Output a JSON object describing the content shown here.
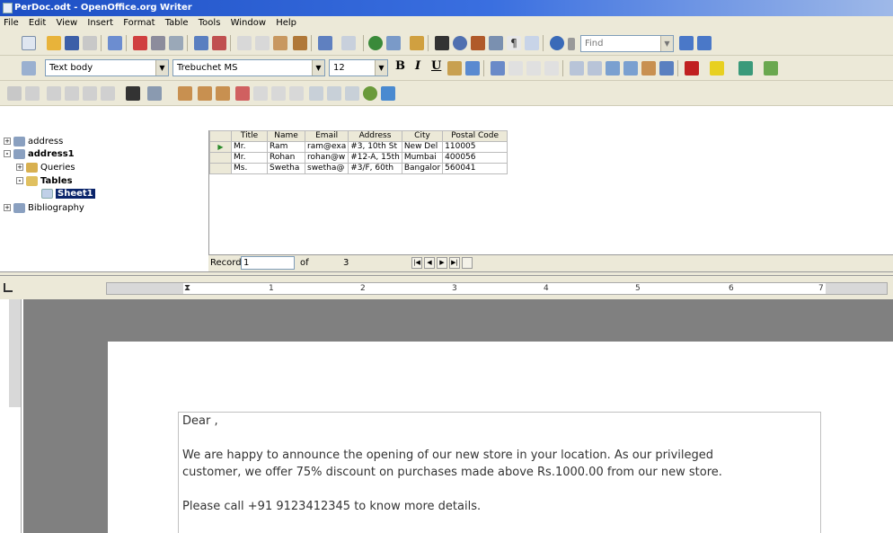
{
  "window": {
    "title": "PerDoc.odt - OpenOffice.org Writer"
  },
  "menu": [
    "File",
    "Edit",
    "View",
    "Insert",
    "Format",
    "Table",
    "Tools",
    "Window",
    "Help"
  ],
  "toolbar": {
    "find_placeholder": "Find",
    "style_value": "Text body",
    "font_value": "Trebuchet MS",
    "size_value": "12"
  },
  "tree": {
    "items": [
      {
        "label": "address",
        "level": 0,
        "expander": "+"
      },
      {
        "label": "address1",
        "level": 0,
        "expander": "-"
      },
      {
        "label": "Queries",
        "level": 1,
        "expander": "+"
      },
      {
        "label": "Tables",
        "level": 1,
        "expander": "-"
      },
      {
        "label": "Sheet1",
        "level": 2,
        "expander": ""
      },
      {
        "label": "Bibliography",
        "level": 0,
        "expander": "+"
      }
    ]
  },
  "grid": {
    "columns": [
      "Title",
      "Name",
      "Email",
      "Address",
      "City",
      "Postal Code"
    ],
    "rows": [
      [
        "Mr.",
        "Ram",
        "ram@exa",
        "#3, 10th St",
        "New Del",
        "110005"
      ],
      [
        "Mr.",
        "Rohan",
        "rohan@w",
        "#12-A, 15th",
        "Mumbai",
        "400056"
      ],
      [
        "Ms.",
        "Swetha",
        "swetha@",
        "#3/F, 60th",
        "Bangalor",
        "560041"
      ]
    ]
  },
  "record_nav": {
    "label": "Record",
    "current": "1",
    "of_label": "of",
    "total": "3"
  },
  "ruler": {
    "numbers": [
      "1",
      "2",
      "3",
      "4",
      "5",
      "6",
      "7"
    ]
  },
  "document": {
    "greeting": "Dear ,",
    "para1_line1": "We are happy to announce the opening of our new store in your location. As our privileged",
    "para1_line2": "customer, we offer 75% discount on purchases made above Rs.1000.00 from our new store.",
    "para2": "Please call +91 9123412345 to know more details."
  }
}
